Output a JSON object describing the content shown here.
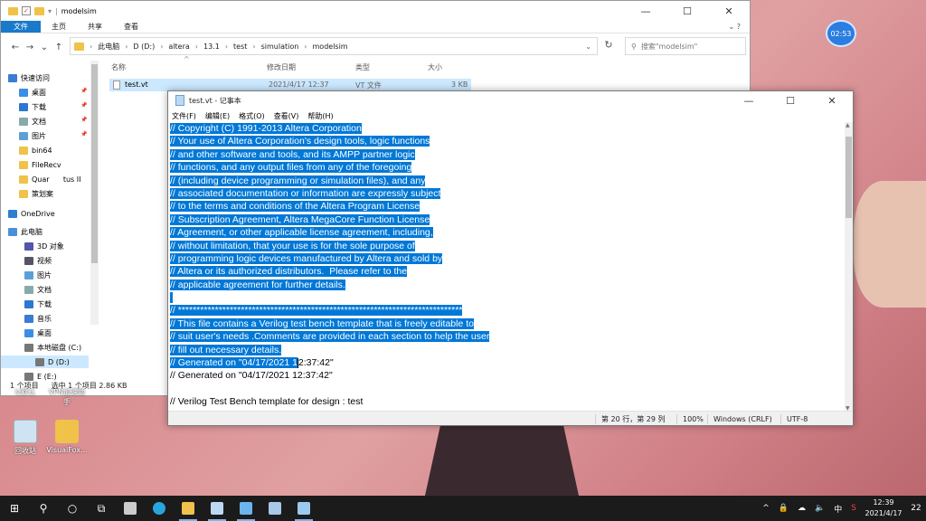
{
  "explorer": {
    "title": "modelsim",
    "tabs": [
      "文件",
      "主页",
      "共享",
      "查看"
    ],
    "nav": {
      "back": "←",
      "forward": "→",
      "recent": "⌄",
      "up": "↑"
    },
    "path": [
      "此电脑",
      "D (D:)",
      "altera",
      "13.1",
      "test",
      "simulation",
      "modelsim"
    ],
    "search_placeholder": "搜索\"modelsim\"",
    "sidebar": [
      {
        "label": "快速访问",
        "icon": "star-icon"
      },
      {
        "label": "桌面",
        "icon": "desktop-icon"
      },
      {
        "label": "下载",
        "icon": "download-icon"
      },
      {
        "label": "文档",
        "icon": "document-icon"
      },
      {
        "label": "图片",
        "icon": "picture-icon"
      },
      {
        "label": "bin64",
        "icon": "folder-icon"
      },
      {
        "label": "FileRecv",
        "icon": "folder-icon"
      },
      {
        "label": "Quar      tus II",
        "icon": "folder-icon"
      },
      {
        "label": "策划案",
        "icon": "folder-icon"
      },
      {
        "label": "OneDrive",
        "icon": "cloud-icon"
      },
      {
        "label": "此电脑",
        "icon": "computer-icon"
      },
      {
        "label": "3D 对象",
        "icon": "3d-icon"
      },
      {
        "label": "视频",
        "icon": "video-icon"
      },
      {
        "label": "图片",
        "icon": "picture-icon"
      },
      {
        "label": "文档",
        "icon": "document-icon"
      },
      {
        "label": "下载",
        "icon": "download-icon"
      },
      {
        "label": "音乐",
        "icon": "music-icon"
      },
      {
        "label": "桌面",
        "icon": "desktop-icon"
      },
      {
        "label": "本地磁盘 (C:)",
        "icon": "drive-icon"
      },
      {
        "label": "D (D:)",
        "icon": "drive-icon"
      },
      {
        "label": "E (E:)",
        "icon": "drive-icon"
      }
    ],
    "columns": [
      "名称",
      "修改日期",
      "类型",
      "大小"
    ],
    "files": [
      {
        "name": "test.vt",
        "modified": "2021/4/17 12:37",
        "type": "VT 文件",
        "size": "3 KB"
      }
    ],
    "status": {
      "count": "1 个项目",
      "selected": "选中 1 个项目  2.86 KB"
    }
  },
  "notepad": {
    "title": "test.vt - 记事本",
    "menus": [
      "文件(F)",
      "编辑(E)",
      "格式(O)",
      "查看(V)",
      "帮助(H)"
    ],
    "lines": [
      "// Copyright (C) 1991-2013 Altera Corporation",
      "// Your use of Altera Corporation's design tools, logic functions",
      "// and other software and tools, and its AMPP partner logic",
      "// functions, and any output files from any of the foregoing",
      "// (including device programming or simulation files), and any",
      "// associated documentation or information are expressly subject",
      "// to the terms and conditions of the Altera Program License",
      "// Subscription Agreement, Altera MegaCore Function License",
      "// Agreement, or other applicable license agreement, including,",
      "// without limitation, that your use is for the sole purpose of",
      "// programming logic devices manufactured by Altera and sold by",
      "// Altera or its authorized distributors.  Please refer to the",
      "// applicable agreement for further details.",
      "",
      "// *****************************************************************************",
      "// This file contains a Verilog test bench template that is freely editable to",
      "// suit user's needs .Comments are provided in each section to help the user",
      "// fill out necessary details.",
      "// *****************************************************************************",
      "// Generated on \"04/17/2021 12:37:42\"",
      "",
      "// Verilog Test Bench template for design : test"
    ],
    "selected_through_line": 19,
    "last_line_selected_part": "// Generated on \"04/17/2021 1",
    "last_line_rest": "2:37:42\"",
    "status": {
      "position": "第 20 行，第 29 列",
      "zoom": "100%",
      "eol": "Windows (CRLF)",
      "encoding": "UTF-8"
    }
  },
  "desktop": {
    "icons": [
      {
        "label": "回收站",
        "icon": "recycle-bin-icon"
      },
      {
        "label": "VisualFox...",
        "icon": "folder-icon"
      }
    ],
    "partial_labels": [
      "Iz默认",
      "VPN加速助\n手"
    ],
    "timer_badge": "02:53"
  },
  "taskbar": {
    "clock_time": "12:39",
    "clock_date": "2021/4/17",
    "notifications": "22",
    "tray_icons": [
      "^",
      "🔒",
      "☁",
      "🔈",
      "中",
      "S"
    ]
  },
  "colors": {
    "accent": "#0078d7",
    "file_tab": "#1979ca",
    "taskbar": "#1b1b1b"
  }
}
